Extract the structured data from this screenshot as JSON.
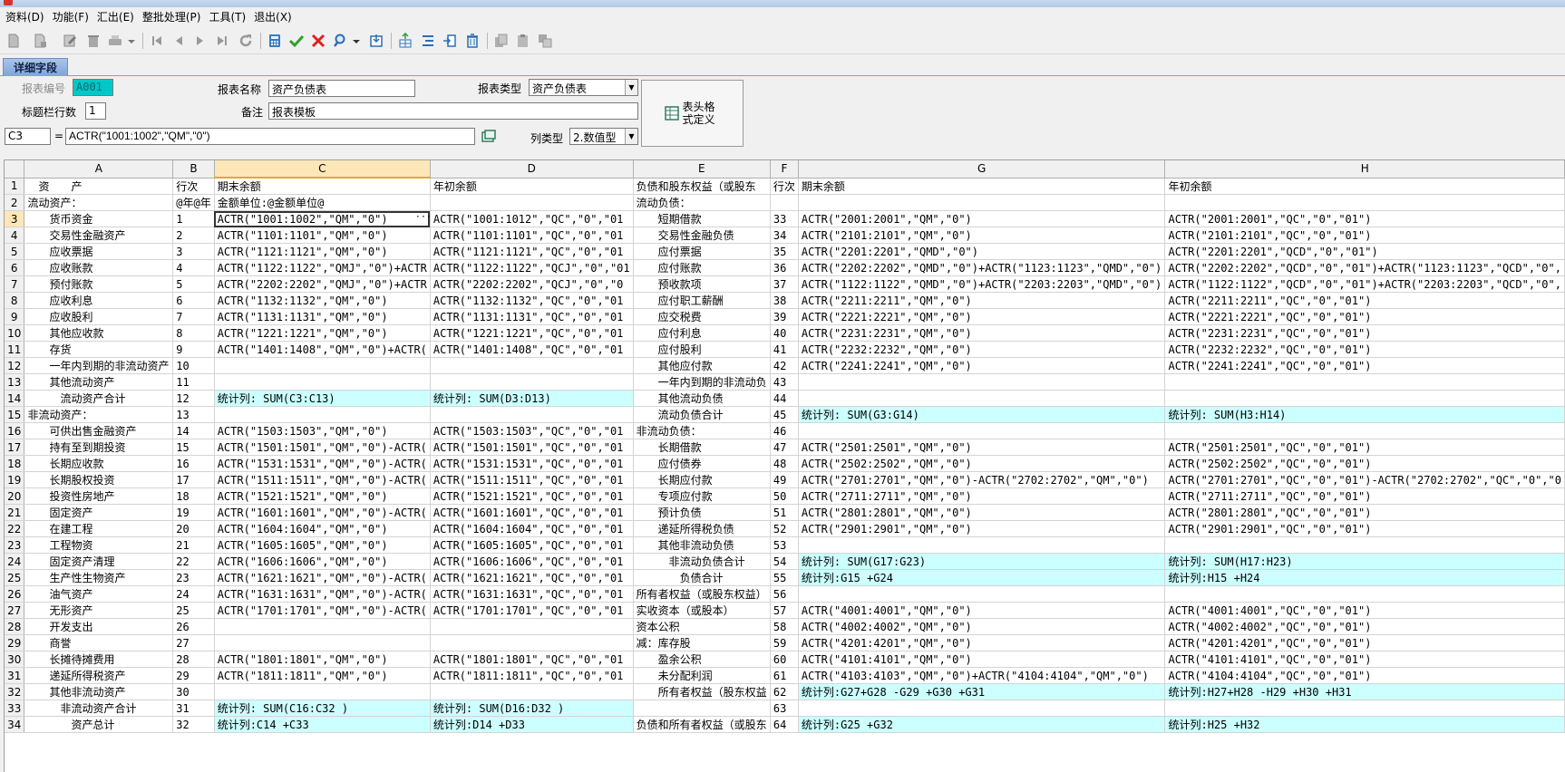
{
  "menu": [
    "资料(D)",
    "功能(F)",
    "汇出(E)",
    "整批处理(P)",
    "工具(T)",
    "退出(X)"
  ],
  "tab": "详细字段",
  "form": {
    "report_no_label": "报表编号",
    "report_no_value": "A001",
    "report_name_label": "报表名称",
    "report_name_value": "资产负债表",
    "report_type_label": "报表类型",
    "report_type_value": "资产负债表",
    "title_rows_label": "标题栏行数",
    "title_rows_value": "1",
    "remark_label": "备注",
    "remark_value": "报表模板",
    "cell_ref": "C3",
    "equals": "=",
    "formula": "ACTR(\"1001:1002\",\"QM\",\"0\")",
    "col_type_label": "列类型",
    "col_type_value": "2.数值型",
    "header_def_button": "表头格式定义",
    "accent_color": "#00c8c8"
  },
  "grid": {
    "columns": [
      "A",
      "B",
      "C",
      "D",
      "E",
      "F",
      "G",
      "H"
    ],
    "selected_column": "C",
    "selected_row": "3",
    "highlight_color": "#ccffff",
    "rows": [
      {
        "n": "1",
        "c": [
          "　资　　产",
          "行次",
          "期末余额",
          "年初余额",
          "负债和股东权益（或股东",
          "行次",
          "期末余额",
          "年初余额"
        ],
        "cy": []
      },
      {
        "n": "2",
        "c": [
          "流动资产：",
          "@年@年",
          "金额单位:@金额单位@",
          "",
          "流动负债：",
          "",
          "",
          ""
        ],
        "cy": []
      },
      {
        "n": "3",
        "c": [
          "　　货币资金",
          "1",
          "ACTR(\"1001:1002\",\"QM\",\"0\")",
          "ACTR(\"1001:1012\",\"QC\",\"0\",\"01",
          "　　短期借款",
          "33",
          "ACTR(\"2001:2001\",\"QM\",\"0\")",
          "ACTR(\"2001:2001\",\"QC\",\"0\",\"01\")"
        ],
        "cy": []
      },
      {
        "n": "4",
        "c": [
          "　　交易性金融资产",
          "2",
          "ACTR(\"1101:1101\",\"QM\",\"0\")",
          "ACTR(\"1101:1101\",\"QC\",\"0\",\"01",
          "　　交易性金融负债",
          "34",
          "ACTR(\"2101:2101\",\"QM\",\"0\")",
          "ACTR(\"2101:2101\",\"QC\",\"0\",\"01\")"
        ],
        "cy": []
      },
      {
        "n": "5",
        "c": [
          "　　应收票据",
          "3",
          "ACTR(\"1121:1121\",\"QM\",\"0\")",
          "ACTR(\"1121:1121\",\"QC\",\"0\",\"01",
          "　　应付票据",
          "35",
          "ACTR(\"2201:2201\",\"QMD\",\"0\")",
          "ACTR(\"2201:2201\",\"QCD\",\"0\",\"01\")"
        ],
        "cy": []
      },
      {
        "n": "6",
        "c": [
          "　　应收账款",
          "4",
          "ACTR(\"1122:1122\",\"QMJ\",\"0\")+ACTR",
          "ACTR(\"1122:1122\",\"QCJ\",\"0\",\"01",
          "　　应付账款",
          "36",
          "ACTR(\"2202:2202\",\"QMD\",\"0\")+ACTR(\"1123:1123\",\"QMD\",\"0\")",
          "ACTR(\"2202:2202\",\"QCD\",\"0\",\"01\")+ACTR(\"1123:1123\",\"QCD\",\"0\","
        ],
        "cy": []
      },
      {
        "n": "7",
        "c": [
          "　　预付账款",
          "5",
          "ACTR(\"2202:2202\",\"QMJ\",\"0\")+ACTR",
          "ACTR(\"2202:2202\",\"QCJ\",\"0\",\"0",
          "　　预收款项",
          "37",
          "ACTR(\"1122:1122\",\"QMD\",\"0\")+ACTR(\"2203:2203\",\"QMD\",\"0\")",
          "ACTR(\"1122:1122\",\"QCD\",\"0\",\"01\")+ACTR(\"2203:2203\",\"QCD\",\"0\","
        ],
        "cy": []
      },
      {
        "n": "8",
        "c": [
          "　　应收利息",
          "6",
          "ACTR(\"1132:1132\",\"QM\",\"0\")",
          "ACTR(\"1132:1132\",\"QC\",\"0\",\"01",
          "　　应付职工薪酬",
          "38",
          "ACTR(\"2211:2211\",\"QM\",\"0\")",
          "ACTR(\"2211:2211\",\"QC\",\"0\",\"01\")"
        ],
        "cy": []
      },
      {
        "n": "9",
        "c": [
          "　　应收股利",
          "7",
          "ACTR(\"1131:1131\",\"QM\",\"0\")",
          "ACTR(\"1131:1131\",\"QC\",\"0\",\"01",
          "　　应交税费",
          "39",
          "ACTR(\"2221:2221\",\"QM\",\"0\")",
          "ACTR(\"2221:2221\",\"QC\",\"0\",\"01\")"
        ],
        "cy": []
      },
      {
        "n": "10",
        "c": [
          "　　其他应收款",
          "8",
          "ACTR(\"1221:1221\",\"QM\",\"0\")",
          "ACTR(\"1221:1221\",\"QC\",\"0\",\"01",
          "　　应付利息",
          "40",
          "ACTR(\"2231:2231\",\"QM\",\"0\")",
          "ACTR(\"2231:2231\",\"QC\",\"0\",\"01\")"
        ],
        "cy": []
      },
      {
        "n": "11",
        "c": [
          "　　存货",
          "9",
          "ACTR(\"1401:1408\",\"QM\",\"0\")+ACTR(",
          "ACTR(\"1401:1408\",\"QC\",\"0\",\"01",
          "　　应付股利",
          "41",
          "ACTR(\"2232:2232\",\"QM\",\"0\")",
          "ACTR(\"2232:2232\",\"QC\",\"0\",\"01\")"
        ],
        "cy": []
      },
      {
        "n": "12",
        "c": [
          "　　一年内到期的非流动资产",
          "10",
          "",
          "",
          "　　其他应付款",
          "42",
          "ACTR(\"2241:2241\",\"QM\",\"0\")",
          "ACTR(\"2241:2241\",\"QC\",\"0\",\"01\")"
        ],
        "cy": []
      },
      {
        "n": "13",
        "c": [
          "　　其他流动资产",
          "11",
          "",
          "",
          "　　一年内到期的非流动负",
          "43",
          "",
          ""
        ],
        "cy": []
      },
      {
        "n": "14",
        "c": [
          "　　　流动资产合计",
          "12",
          "统计列: SUM(C3:C13)",
          "统计列: SUM(D3:D13)",
          "　　其他流动负债",
          "44",
          "",
          ""
        ],
        "cy": [
          2,
          3
        ]
      },
      {
        "n": "15",
        "c": [
          "非流动资产：",
          "13",
          "",
          "",
          "　　流动负债合计",
          "45",
          "统计列: SUM(G3:G14)",
          "统计列: SUM(H3:H14)"
        ],
        "cy": [
          6,
          7
        ]
      },
      {
        "n": "16",
        "c": [
          "　　可供出售金融资产",
          "14",
          "ACTR(\"1503:1503\",\"QM\",\"0\")",
          "ACTR(\"1503:1503\",\"QC\",\"0\",\"01",
          "非流动负债：",
          "46",
          "",
          ""
        ],
        "cy": []
      },
      {
        "n": "17",
        "c": [
          "　　持有至到期投资",
          "15",
          "ACTR(\"1501:1501\",\"QM\",\"0\")-ACTR(",
          "ACTR(\"1501:1501\",\"QC\",\"0\",\"01",
          "　　长期借款",
          "47",
          "ACTR(\"2501:2501\",\"QM\",\"0\")",
          "ACTR(\"2501:2501\",\"QC\",\"0\",\"01\")"
        ],
        "cy": []
      },
      {
        "n": "18",
        "c": [
          "　　长期应收款",
          "16",
          "ACTR(\"1531:1531\",\"QM\",\"0\")-ACTR(",
          "ACTR(\"1531:1531\",\"QC\",\"0\",\"01",
          "　　应付债券",
          "48",
          "ACTR(\"2502:2502\",\"QM\",\"0\")",
          "ACTR(\"2502:2502\",\"QC\",\"0\",\"01\")"
        ],
        "cy": []
      },
      {
        "n": "19",
        "c": [
          "　　长期股权投资",
          "17",
          "ACTR(\"1511:1511\",\"QM\",\"0\")-ACTR(",
          "ACTR(\"1511:1511\",\"QC\",\"0\",\"01",
          "　　长期应付款",
          "49",
          "ACTR(\"2701:2701\",\"QM\",\"0\")-ACTR(\"2702:2702\",\"QM\",\"0\")",
          "ACTR(\"2701:2701\",\"QC\",\"0\",\"01\")-ACTR(\"2702:2702\",\"QC\",\"0\",\"0"
        ],
        "cy": []
      },
      {
        "n": "20",
        "c": [
          "　　投资性房地产",
          "18",
          "ACTR(\"1521:1521\",\"QM\",\"0\")",
          "ACTR(\"1521:1521\",\"QC\",\"0\",\"01",
          "　　专项应付款",
          "50",
          "ACTR(\"2711:2711\",\"QM\",\"0\")",
          "ACTR(\"2711:2711\",\"QC\",\"0\",\"01\")"
        ],
        "cy": []
      },
      {
        "n": "21",
        "c": [
          "　　固定资产",
          "19",
          "ACTR(\"1601:1601\",\"QM\",\"0\")-ACTR(",
          "ACTR(\"1601:1601\",\"QC\",\"0\",\"01",
          "　　预计负债",
          "51",
          "ACTR(\"2801:2801\",\"QM\",\"0\")",
          "ACTR(\"2801:2801\",\"QC\",\"0\",\"01\")"
        ],
        "cy": []
      },
      {
        "n": "22",
        "c": [
          "　　在建工程",
          "20",
          "ACTR(\"1604:1604\",\"QM\",\"0\")",
          "ACTR(\"1604:1604\",\"QC\",\"0\",\"01",
          "　　递延所得税负债",
          "52",
          "ACTR(\"2901:2901\",\"QM\",\"0\")",
          "ACTR(\"2901:2901\",\"QC\",\"0\",\"01\")"
        ],
        "cy": []
      },
      {
        "n": "23",
        "c": [
          "　　工程物资",
          "21",
          "ACTR(\"1605:1605\",\"QM\",\"0\")",
          "ACTR(\"1605:1605\",\"QC\",\"0\",\"01",
          "　　其他非流动负债",
          "53",
          "",
          ""
        ],
        "cy": []
      },
      {
        "n": "24",
        "c": [
          "　　固定资产清理",
          "22",
          "ACTR(\"1606:1606\",\"QM\",\"0\")",
          "ACTR(\"1606:1606\",\"QC\",\"0\",\"01",
          "　　　非流动负债合计",
          "54",
          "统计列: SUM(G17:G23)",
          "统计列: SUM(H17:H23)"
        ],
        "cy": [
          6,
          7
        ]
      },
      {
        "n": "25",
        "c": [
          "　　生产性生物资产",
          "23",
          "ACTR(\"1621:1621\",\"QM\",\"0\")-ACTR(",
          "ACTR(\"1621:1621\",\"QC\",\"0\",\"01",
          "　　　　负债合计",
          "55",
          "统计列:G15 +G24",
          "统计列:H15 +H24"
        ],
        "cy": [
          6,
          7
        ]
      },
      {
        "n": "26",
        "c": [
          "　　油气资产",
          "24",
          "ACTR(\"1631:1631\",\"QM\",\"0\")-ACTR(",
          "ACTR(\"1631:1631\",\"QC\",\"0\",\"01",
          "所有者权益（或股东权益）",
          "56",
          "",
          ""
        ],
        "cy": []
      },
      {
        "n": "27",
        "c": [
          "　　无形资产",
          "25",
          "ACTR(\"1701:1701\",\"QM\",\"0\")-ACTR(",
          "ACTR(\"1701:1701\",\"QC\",\"0\",\"01",
          "实收资本（或股本）",
          "57",
          "ACTR(\"4001:4001\",\"QM\",\"0\")",
          "ACTR(\"4001:4001\",\"QC\",\"0\",\"01\")"
        ],
        "cy": []
      },
      {
        "n": "28",
        "c": [
          "　　开发支出",
          "26",
          "",
          "",
          "资本公积",
          "58",
          "ACTR(\"4002:4002\",\"QM\",\"0\")",
          "ACTR(\"4002:4002\",\"QC\",\"0\",\"01\")"
        ],
        "cy": []
      },
      {
        "n": "29",
        "c": [
          "　　商誉",
          "27",
          "",
          "",
          "减：库存股",
          "59",
          "ACTR(\"4201:4201\",\"QM\",\"0\")",
          "ACTR(\"4201:4201\",\"QC\",\"0\",\"01\")"
        ],
        "cy": []
      },
      {
        "n": "30",
        "c": [
          "　　长摊待摊费用",
          "28",
          "ACTR(\"1801:1801\",\"QM\",\"0\")",
          "ACTR(\"1801:1801\",\"QC\",\"0\",\"01",
          "　　盈余公积",
          "60",
          "ACTR(\"4101:4101\",\"QM\",\"0\")",
          "ACTR(\"4101:4101\",\"QC\",\"0\",\"01\")"
        ],
        "cy": []
      },
      {
        "n": "31",
        "c": [
          "　　递延所得税资产",
          "29",
          "ACTR(\"1811:1811\",\"QM\",\"0\")",
          "ACTR(\"1811:1811\",\"QC\",\"0\",\"01",
          "　　未分配利润",
          "61",
          "ACTR(\"4103:4103\",\"QM\",\"0\")+ACTR(\"4104:4104\",\"QM\",\"0\")",
          "ACTR(\"4104:4104\",\"QC\",\"0\",\"01\")"
        ],
        "cy": []
      },
      {
        "n": "32",
        "c": [
          "　　其他非流动资产",
          "30",
          "",
          "",
          "　　所有者权益（股东权益",
          "62",
          "统计列:G27+G28 -G29 +G30 +G31",
          "统计列:H27+H28 -H29 +H30 +H31"
        ],
        "cy": [
          6,
          7
        ]
      },
      {
        "n": "33",
        "c": [
          "　　　非流动资产合计",
          "31",
          "统计列: SUM(C16:C32 )",
          "统计列: SUM(D16:D32 )",
          "",
          "63",
          "",
          ""
        ],
        "cy": [
          2,
          3
        ]
      },
      {
        "n": "34",
        "c": [
          "　　　　资产总计",
          "32",
          "统计列:C14 +C33",
          "统计列:D14 +D33",
          "负债和所有者权益（或股东",
          "64",
          "统计列:G25 +G32",
          "统计列:H25 +H32"
        ],
        "cy": [
          2,
          3,
          6,
          7
        ]
      }
    ]
  }
}
